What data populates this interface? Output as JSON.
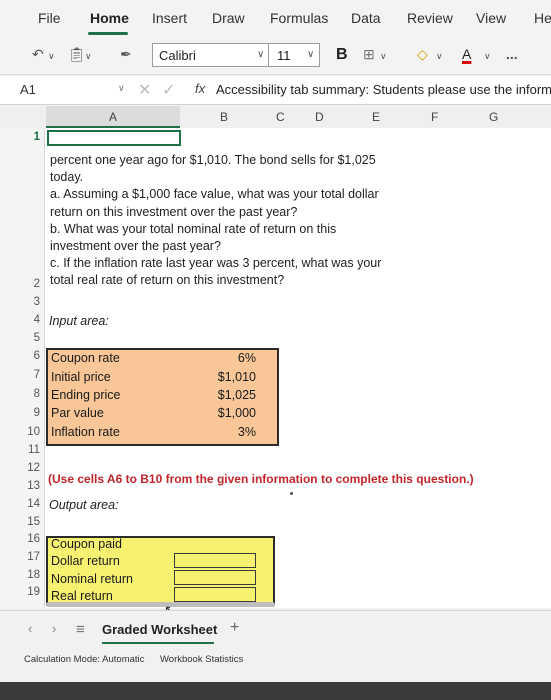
{
  "ribbon": {
    "tabs": [
      "File",
      "Home",
      "Insert",
      "Draw",
      "Formulas",
      "Data",
      "Review",
      "View",
      "He"
    ],
    "active_tab": "Home"
  },
  "toolbar": {
    "font_name": "Calibri",
    "font_size": "11",
    "bold_label": "B",
    "more_label": "..."
  },
  "formula_bar": {
    "name_box": "A1",
    "fx_label": "fx",
    "content": "Accessibility tab summary: Students please use the informa"
  },
  "columns": [
    "A",
    "B",
    "C",
    "D",
    "E",
    "F",
    "G"
  ],
  "rows": [
    "1",
    "2",
    "3",
    "4",
    "5",
    "6",
    "7",
    "8",
    "9",
    "10",
    "11",
    "12",
    "13",
    "14",
    "15",
    "16",
    "17",
    "18",
    "19"
  ],
  "problem_text": [
    "percent one year ago for $1,010. The bond sells for $1,025",
    "today.",
    "a. Assuming a $1,000 face value, what was your total dollar",
    "return on this investment over the past year?",
    "b. What was your total nominal rate of return on this",
    "investment over the past year?",
    "c. If the inflation rate last year was 3 percent, what was your",
    "total real rate of return on this investment?"
  ],
  "input_label": "Input area:",
  "inputs": [
    {
      "label": "Coupon rate",
      "value": "6%"
    },
    {
      "label": "Initial price",
      "value": "$1,010"
    },
    {
      "label": "Ending price",
      "value": "$1,025"
    },
    {
      "label": "Par value",
      "value": "$1,000"
    },
    {
      "label": "Inflation rate",
      "value": "3%"
    }
  ],
  "instruction": "(Use cells A6 to B10 from the given information to complete this question.)",
  "output_label": "Output area:",
  "outputs": [
    "Coupon paid",
    "Dollar return",
    "Nominal return",
    "Real return"
  ],
  "sheet_tab": "Graded Worksheet",
  "add_sheet": "+",
  "status": {
    "calc_mode": "Calculation Mode: Automatic",
    "stats": "Workbook Statistics"
  },
  "colors": {
    "accent": "#1e7145",
    "input_fill": "#f8c697",
    "output_fill": "#f7f171",
    "instruction_text": "#c0262c"
  }
}
